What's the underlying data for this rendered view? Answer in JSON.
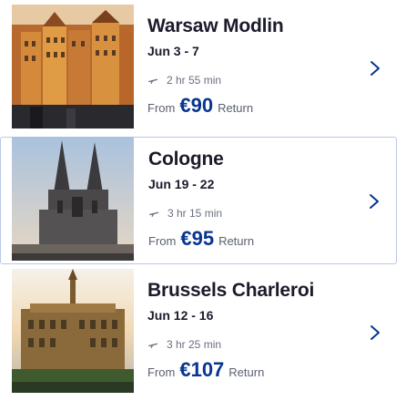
{
  "destinations": [
    {
      "city": "Warsaw Modlin",
      "dates": "Jun 3 - 7",
      "duration": "2 hr 55 min",
      "from_label": "From",
      "price": "€90",
      "return_label": "Return"
    },
    {
      "city": "Cologne",
      "dates": "Jun 19 - 22",
      "duration": "3 hr 15 min",
      "from_label": "From",
      "price": "€95",
      "return_label": "Return"
    },
    {
      "city": "Brussels Charleroi",
      "dates": "Jun 12 - 16",
      "duration": "3 hr 25 min",
      "from_label": "From",
      "price": "€107",
      "return_label": "Return"
    }
  ],
  "colors": {
    "price": "#073590",
    "chevron": "#073590",
    "title": "#1b1b2b",
    "muted": "#6b6f80",
    "selected_border": "#b8c8e6"
  },
  "icons": {
    "duration": "plane-icon",
    "open": "chevron-right-icon"
  }
}
